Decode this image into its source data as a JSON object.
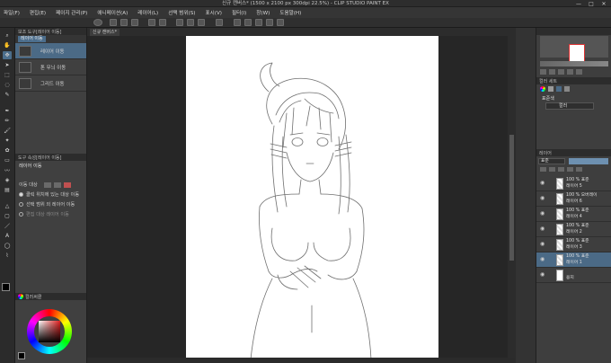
{
  "window": {
    "title": "신규 캔버스* (1500 x 2100 px 300dpi 22.5%) - CLIP STUDIO PAINT EX",
    "minimize": "—",
    "maximize": "□",
    "close": "✕"
  },
  "menubar": {
    "items": [
      "파일(F)",
      "편집(E)",
      "페이지 관리(P)",
      "애니메이션(A)",
      "레이어(L)",
      "선택 범위(S)",
      "표시(V)",
      "필터(I)",
      "창(W)",
      "도움말(H)"
    ]
  },
  "subtool": {
    "header": "보조 도구[레이어 이동]",
    "tab": "레이어 이동",
    "items": [
      "레이어 이동",
      "톤 무늬 이동",
      "그리드 이동"
    ],
    "selected_index": 0
  },
  "toolprop": {
    "header": "도구 속성[레이어 이동]",
    "title": "레이어 이동",
    "rows": [
      {
        "label": "이동 대상",
        "type": "label"
      },
      {
        "label": "클릭 위치에 있는 대상 이동",
        "type": "radio",
        "on": true
      },
      {
        "label": "선택 범위 외 레이어 이동",
        "type": "radio",
        "on": false
      },
      {
        "label": "편집 대상 레이어 이동",
        "type": "radio",
        "on": false
      }
    ]
  },
  "colorpanel": {
    "header": "컬러써클"
  },
  "canvas": {
    "tab_label": "신규 캔버스*"
  },
  "colorset": {
    "header": "컬러 세트",
    "label": "표준색",
    "dropdown": "컬러"
  },
  "layerpanel": {
    "header": "레이어",
    "blend": "표준",
    "opacity": "100",
    "layers": [
      {
        "percent": "100 % 표준",
        "name": "레이어 5",
        "selected": false
      },
      {
        "percent": "100 % 오버레이",
        "name": "레이어 6",
        "selected": false
      },
      {
        "percent": "100 % 표준",
        "name": "레이어 4",
        "selected": false
      },
      {
        "percent": "100 % 표준",
        "name": "레이어 2",
        "selected": false
      },
      {
        "percent": "100 % 표준",
        "name": "레이어 3",
        "selected": false
      },
      {
        "percent": "100 % 표준",
        "name": "레이어 1",
        "selected": true
      },
      {
        "percent": "",
        "name": "용지",
        "selected": false
      }
    ]
  },
  "colors": {
    "accent": "#4b6a86",
    "panel": "#404040",
    "canvas_bg": "#262626"
  }
}
